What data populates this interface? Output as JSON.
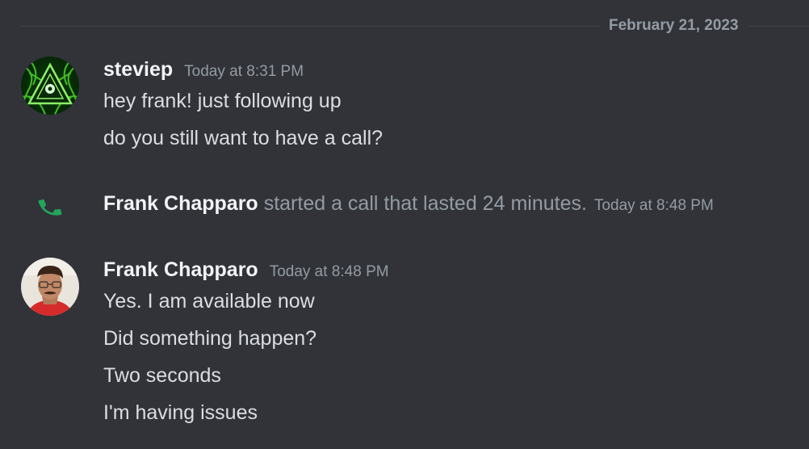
{
  "date_divider": "February 21, 2023",
  "group1": {
    "username": "steviep",
    "timestamp": "Today at 8:31 PM",
    "avatar": "green-geometric-triangle-avatar",
    "messages": [
      "hey frank! just following up",
      "do you still want to have a call?"
    ]
  },
  "call": {
    "icon": "phone-icon",
    "user": "Frank Chapparo",
    "text": "started a call that lasted 24 minutes.",
    "timestamp": "Today at 8:48 PM",
    "icon_color": "#23a55a"
  },
  "group2": {
    "username": "Frank Chapparo",
    "timestamp": "Today at 8:48 PM",
    "avatar": "photo-avatar",
    "messages": [
      "Yes. I am available now",
      "Did something happen?",
      "Two seconds",
      "I'm having issues"
    ]
  },
  "colors": {
    "background": "#313338",
    "username": "#f2f3f5",
    "muted": "#949ba4",
    "text": "#dbdee1"
  }
}
